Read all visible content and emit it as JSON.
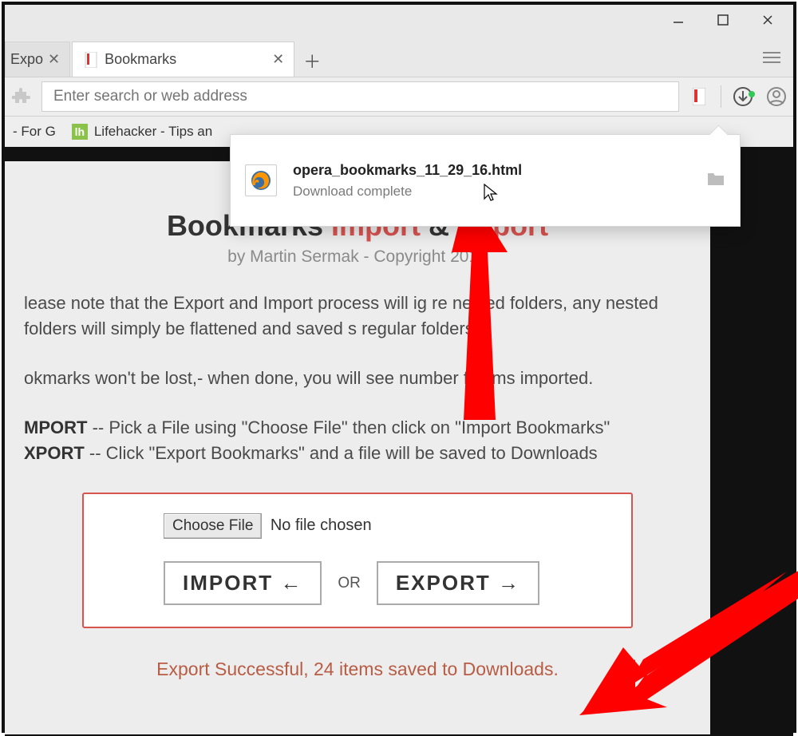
{
  "window": {
    "tabs": {
      "inactive_title": "Expo",
      "active_title": "Bookmarks"
    },
    "address_placeholder": "Enter search or web address",
    "bookmarks_bar": {
      "item1": "- For G",
      "item2": "Lifehacker - Tips an"
    }
  },
  "download": {
    "filename": "opera_bookmarks_11_29_16.html",
    "status": "Download complete"
  },
  "page": {
    "title_prefix": "Bookmarks ",
    "title_import": "Import",
    "title_amp": " & ",
    "title_export": "Export",
    "byline": "by Martin Sermak - Copyright     2016",
    "para1": "lease note that the Export and Import process will ig    re nested folders,   any nested folders will simply be flattened and saved  s regular folders.",
    "para2": "okmarks won't be lost,- when done, you will see number  f items imported.",
    "import_label": "MPORT",
    "import_desc": " -- Pick a File using \"Choose File\" then click on \"Import Bookmarks\"",
    "export_label": "XPORT",
    "export_desc": " -- Click \"Export Bookmarks\" and a file will be saved to Downloads",
    "choose_file_btn": "Choose File",
    "no_file": "No file chosen",
    "import_btn": "IMPORT  ←",
    "or": "OR",
    "export_btn": "EXPORT  →",
    "result": "Export Successful, 24 items saved to Downloads."
  }
}
